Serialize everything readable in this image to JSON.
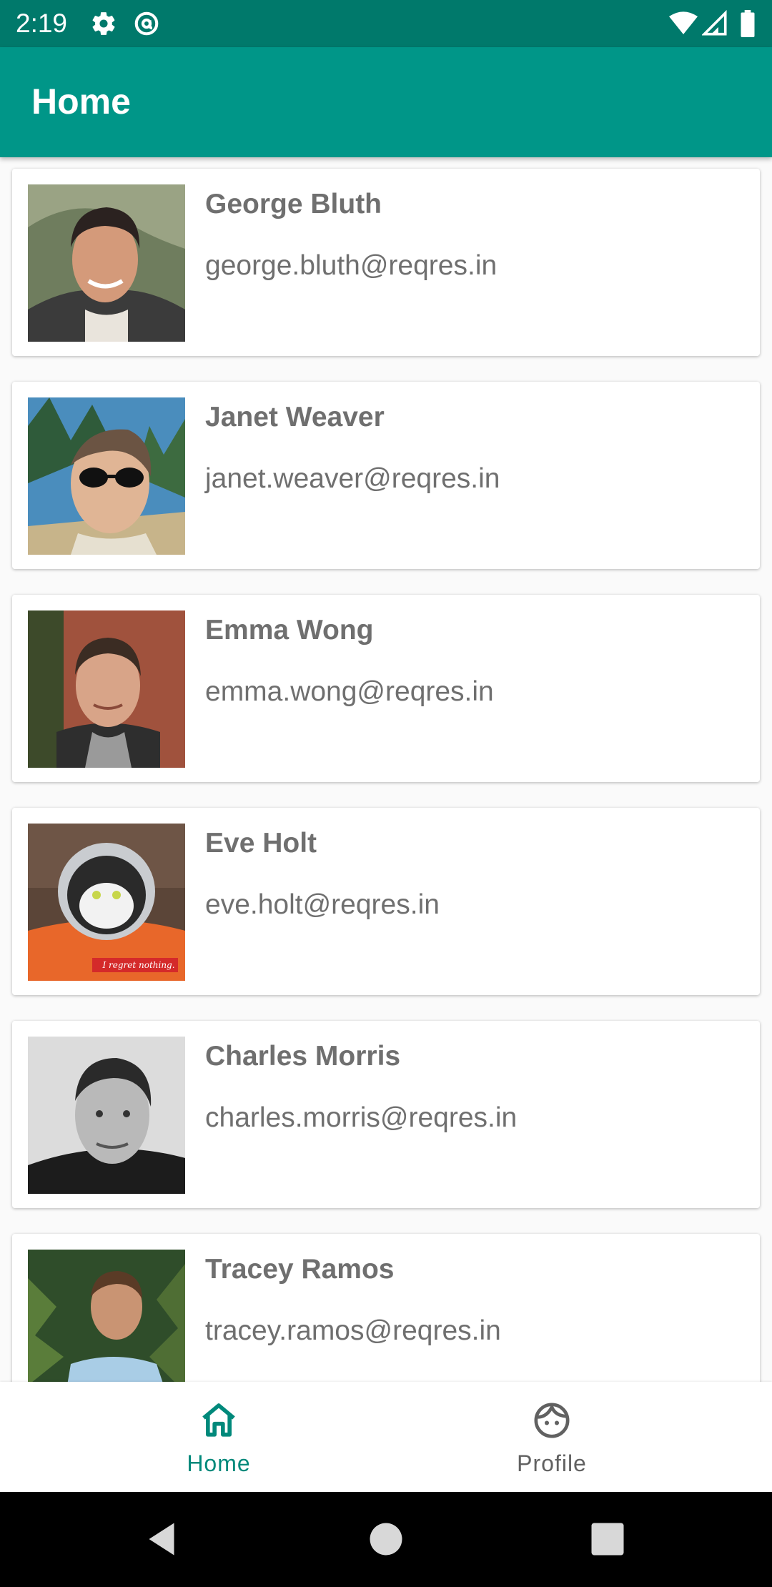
{
  "status_bar": {
    "time": "2:19",
    "icons_left": [
      "settings-icon",
      "at-sign-icon"
    ],
    "icons_right": [
      "wifi-icon",
      "signal-icon",
      "battery-icon"
    ],
    "color": "#00796b"
  },
  "app_bar": {
    "title": "Home",
    "color": "#009688"
  },
  "users": [
    {
      "name": "George Bluth",
      "email": "george.bluth@reqres.in"
    },
    {
      "name": "Janet Weaver",
      "email": "janet.weaver@reqres.in"
    },
    {
      "name": "Emma Wong",
      "email": "emma.wong@reqres.in"
    },
    {
      "name": "Eve Holt",
      "email": "eve.holt@reqres.in",
      "avatar_caption": "I regret nothing."
    },
    {
      "name": "Charles Morris",
      "email": "charles.morris@reqres.in"
    },
    {
      "name": "Tracey Ramos",
      "email": "tracey.ramos@reqres.in"
    }
  ],
  "bottom_nav": {
    "items": [
      {
        "label": "Home",
        "icon": "home-icon",
        "selected": true
      },
      {
        "label": "Profile",
        "icon": "face-icon",
        "selected": false
      }
    ],
    "active_color": "#00897b",
    "inactive_color": "#616161"
  },
  "system_nav": {
    "buttons": [
      "back-icon",
      "home-circle-icon",
      "recents-icon"
    ]
  }
}
